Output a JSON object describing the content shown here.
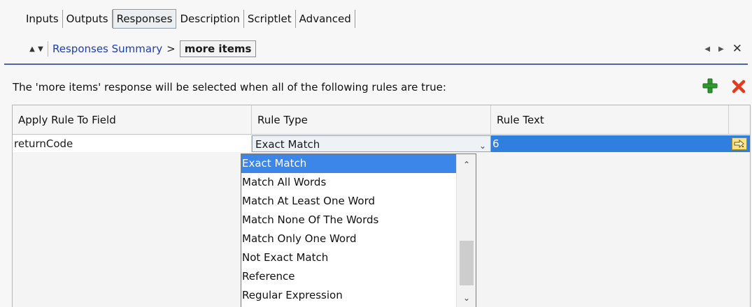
{
  "tabs": [
    {
      "label": "Inputs",
      "active": false
    },
    {
      "label": "Outputs",
      "active": false
    },
    {
      "label": "Responses",
      "active": true
    },
    {
      "label": "Description",
      "active": false
    },
    {
      "label": "Scriptlet",
      "active": false
    },
    {
      "label": "Advanced",
      "active": false
    }
  ],
  "breadcrumb": {
    "up_icon": "triangle-up",
    "down_icon": "triangle-down",
    "link": "Responses Summary",
    "separator": ">",
    "current": "more items"
  },
  "nav": {
    "prev_icon": "triangle-left",
    "next_icon": "triangle-right",
    "close_glyph": "✕"
  },
  "description": "The 'more items' response will be selected when all of the following rules are true:",
  "toolbar": {
    "add_icon": "plus-icon",
    "delete_icon": "delete-x-icon",
    "add_color": "#2e9a2e",
    "delete_color": "#e23c1c"
  },
  "table": {
    "headers": [
      "Apply Rule To Field",
      "Rule Type",
      "Rule Text"
    ],
    "row": {
      "field": "returnCode",
      "rule_type": "Exact Match",
      "rule_text": "6"
    }
  },
  "dropdown": {
    "options": [
      "Exact Match",
      "Match All Words",
      "Match At Least One Word",
      "Match None Of The Words",
      "Match Only One Word",
      "Not Exact Match",
      "Reference",
      "Regular Expression"
    ],
    "selected_index": 0
  },
  "colors": {
    "selection": "#3b86e8",
    "link": "#1a3db8",
    "divider": "#4b66a8"
  }
}
